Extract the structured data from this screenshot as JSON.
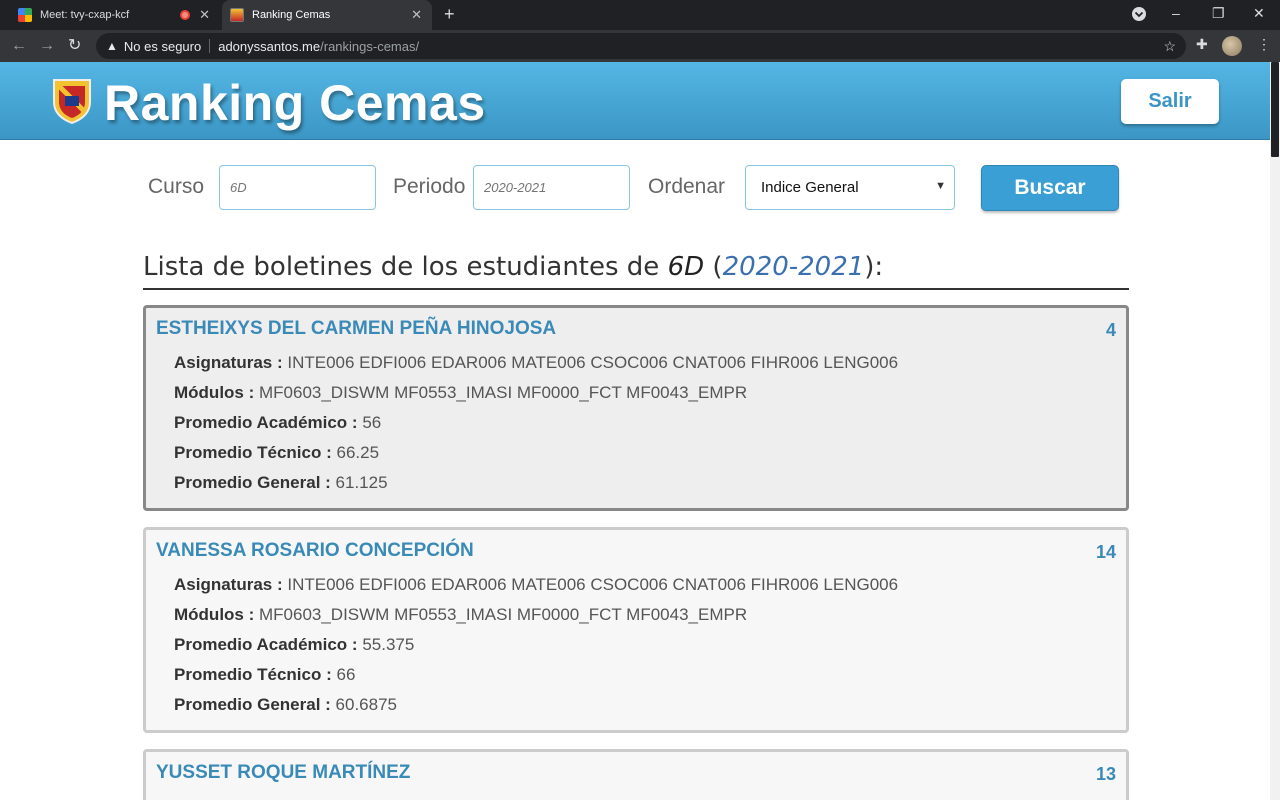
{
  "browser": {
    "tabs": [
      {
        "title": "Meet: tvy-cxap-kcf"
      },
      {
        "title": "Ranking Cemas"
      }
    ],
    "omnibox": {
      "security": "No es seguro",
      "host": "adonyssantos.me",
      "path": "/rankings-cemas/"
    }
  },
  "header": {
    "title": "Ranking Cemas",
    "logout_label": "Salir"
  },
  "filters": {
    "course_label": "Curso",
    "course_placeholder": "6D",
    "period_label": "Periodo",
    "period_placeholder": "2020-2021",
    "order_label": "Ordenar",
    "order_selected": "Indice General",
    "search_label": "Buscar"
  },
  "list": {
    "title_prefix": "Lista de boletines de los estudiantes de ",
    "course": "6D",
    "open_paren": " (",
    "period": "2020-2021",
    "close": "):"
  },
  "field_labels": {
    "subjects": "Asignaturas : ",
    "modules": "Módulos : ",
    "academic": "Promedio Académico : ",
    "technical": "Promedio Técnico : ",
    "general": "Promedio General : "
  },
  "students": [
    {
      "name": "ESTHEIXYS DEL CARMEN PEÑA HINOJOSA",
      "rank": "4",
      "subjects": "INTE006 EDFI006 EDAR006 MATE006 CSOC006 CNAT006 FIHR006 LENG006",
      "modules": "MF0603_DISWM MF0553_IMASI MF0000_FCT MF0043_EMPR",
      "academic": "56",
      "technical": "66.25",
      "general": "61.125"
    },
    {
      "name": "VANESSA ROSARIO CONCEPCIÓN",
      "rank": "14",
      "subjects": "INTE006 EDFI006 EDAR006 MATE006 CSOC006 CNAT006 FIHR006 LENG006",
      "modules": "MF0603_DISWM MF0553_IMASI MF0000_FCT MF0043_EMPR",
      "academic": "55.375",
      "technical": "66",
      "general": "60.6875"
    },
    {
      "name": "YUSSET ROQUE MARTÍNEZ",
      "rank": "13"
    }
  ]
}
